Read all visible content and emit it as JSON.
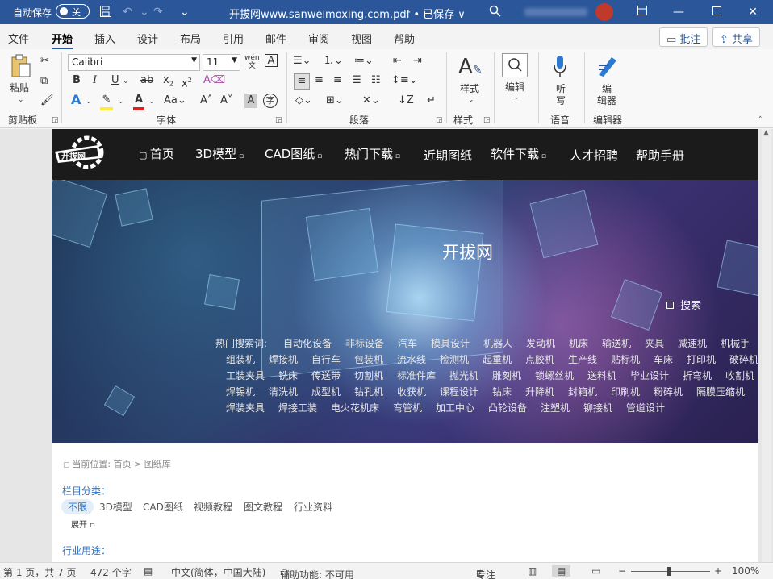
{
  "titlebar": {
    "autosave_label": "自动保存",
    "autosave_state": "关",
    "doc_title": "开拔网www.sanweimoxing.com.pdf • 已保存 ∨"
  },
  "tabs": [
    "文件",
    "开始",
    "插入",
    "设计",
    "布局",
    "引用",
    "邮件",
    "审阅",
    "视图",
    "帮助"
  ],
  "actions": {
    "comment": "批注",
    "share": "共享"
  },
  "ribbon": {
    "clipboard": {
      "paste": "粘贴",
      "label": "剪贴板"
    },
    "font": {
      "name": "Calibri",
      "size": "11",
      "label": "字体"
    },
    "paragraph": {
      "label": "段落"
    },
    "styles": {
      "button": "样式",
      "label": "样式"
    },
    "editing": {
      "button": "编辑"
    },
    "voice": {
      "button_line1": "听",
      "button_line2": "写",
      "label": "语音"
    },
    "editor": {
      "button_line1": "编",
      "button_line2": "辑器",
      "label": "编辑器"
    }
  },
  "site": {
    "nav": [
      "首页",
      "3D模型",
      "CAD图纸",
      "热门下载",
      "近期图纸",
      "软件下载",
      "人才招聘",
      "帮助手册"
    ],
    "banner_title": "开拔网",
    "search": "搜索",
    "hot_label": "热门搜索词:",
    "keywords": [
      [
        "自动化设备",
        "非标设备",
        "汽车",
        "模具设计",
        "机器人",
        "发动机",
        "机床",
        "输送机",
        "夹具",
        "减速机",
        "机械手"
      ],
      [
        "组装机",
        "焊接机",
        "自行车",
        "包装机",
        "流水线",
        "检测机",
        "起重机",
        "点胶机",
        "生产线",
        "贴标机",
        "车床",
        "打印机",
        "破碎机"
      ],
      [
        "工装夹具",
        "铣床",
        "传送带",
        "切割机",
        "标准件库",
        "抛光机",
        "雕刻机",
        "锁螺丝机",
        "送料机",
        "毕业设计",
        "折弯机",
        "收割机"
      ],
      [
        "焊锡机",
        "清洗机",
        "成型机",
        "钻孔机",
        "收获机",
        "课程设计",
        "钻床",
        "升降机",
        "封箱机",
        "印刷机",
        "粉碎机",
        "隔膜压缩机"
      ],
      [
        "焊装夹具",
        "焊接工装",
        "电火花机床",
        "弯管机",
        "加工中心",
        "凸轮设备",
        "注塑机",
        "铆接机",
        "管道设计"
      ]
    ],
    "breadcrumb": "当前位置:   首页  >  图纸库",
    "category_label": "栏目分类：",
    "categories": [
      "不限",
      "3D模型",
      "CAD图纸",
      "视频教程",
      "图文教程",
      "行业资料"
    ],
    "expand": "展开",
    "usage_label": "行业用途："
  },
  "status": {
    "page": "第 1 页，共 7 页",
    "words": "472 个字",
    "language": "中文(简体，中国大陆)",
    "accessibility": "辅助功能: 不可用",
    "focus": "专注",
    "zoom": "100%"
  }
}
